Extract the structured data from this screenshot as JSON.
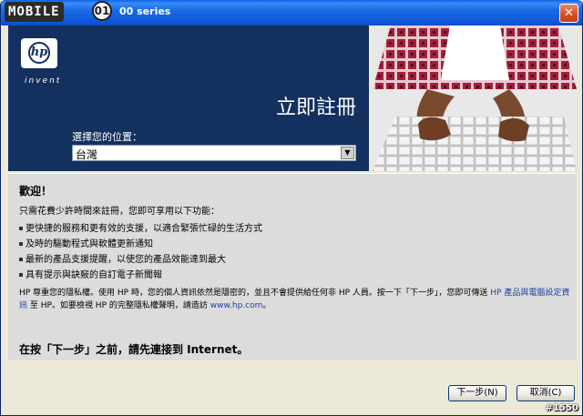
{
  "window": {
    "title_logo": "MOBILE",
    "title_circle": "01",
    "title_text": "00 series",
    "close_glyph": "✕"
  },
  "header": {
    "logo_text": "hp",
    "logo_tagline": "invent",
    "register_title": "立即註冊",
    "location_label": "選擇您的位置：",
    "location_value": "台灣"
  },
  "body": {
    "welcome": "歡迎！",
    "intro": "只需花費少許時間來註冊，您即可享用以下功能：",
    "features": [
      "更快捷的服務和更有效的支援，以適合緊張忙碌的生活方式",
      "及時的驅動程式與軟體更新通知",
      "最新的產品支援提醒，以使您的產品效能達到最大",
      "具有提示與訣竅的自訂電子新聞報"
    ],
    "privacy_part1": "HP 尊重您的隱私權。使用 HP 時，您的個人資訊依然是隱密的，並且不會提供給任何非 HP 人員。按一下「下一步」，您即可傳送",
    "privacy_link1": "HP 產品與電腦設定資訊",
    "privacy_part2": "至 HP。如要檢視 HP 的完整隱私權聲明，請造訪",
    "privacy_link2": "www.hp.com",
    "privacy_part3": "。",
    "connect_notice": "在按「下一步」之前，請先連接到 Internet。"
  },
  "buttons": {
    "next_label": "下一步(N)",
    "cancel_label": "取消(C)"
  },
  "watermark": "#1550",
  "colors": {
    "header_blue": "#13305e",
    "title_bar": "#0f58d8",
    "link": "#1e3fa0"
  }
}
